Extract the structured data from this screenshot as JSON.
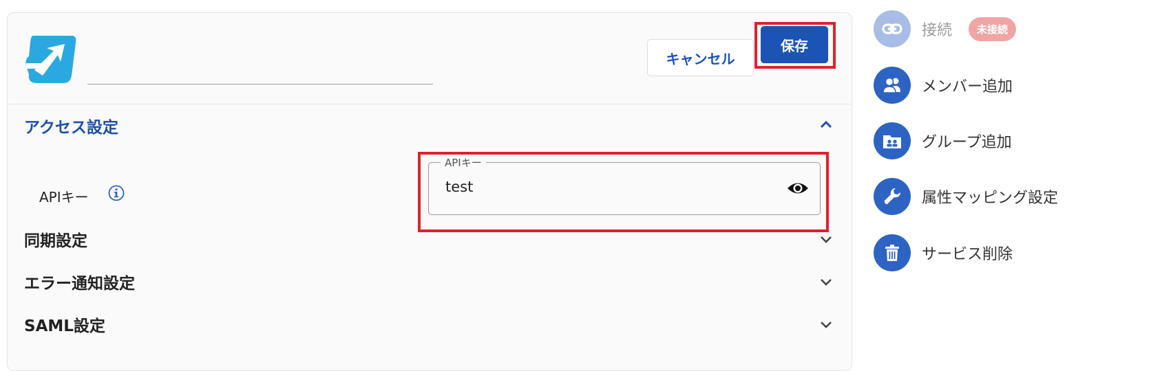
{
  "header": {
    "service_name_value": "",
    "cancel_label": "キャンセル",
    "save_label": "保存"
  },
  "sections": {
    "access": {
      "title": "アクセス設定",
      "expanded": true
    },
    "sync": {
      "title": "同期設定",
      "expanded": false
    },
    "error_notify": {
      "title": "エラー通知設定",
      "expanded": false
    },
    "saml": {
      "title": "SAML設定",
      "expanded": false
    }
  },
  "api_key": {
    "label": "APIキー",
    "field_legend": "APIキー",
    "value": "test"
  },
  "sidebar": {
    "connection": {
      "label": "接続",
      "badge": "未接続",
      "icon": "link-icon"
    },
    "add_member": {
      "label": "メンバー追加",
      "icon": "people-icon"
    },
    "add_group": {
      "label": "グループ追加",
      "icon": "group-folder-icon"
    },
    "attribute_mapping": {
      "label": "属性マッピング設定",
      "icon": "wrench-icon"
    },
    "delete_service": {
      "label": "サービス削除",
      "icon": "trash-icon"
    }
  },
  "colors": {
    "primary": "#1b54b4",
    "highlight": "#e0202e",
    "badge_bg": "#f0a5a5",
    "icon_bg": "#2d63c3",
    "icon_bg_disabled": "#a8bde6",
    "logo": "#29a9e0"
  }
}
